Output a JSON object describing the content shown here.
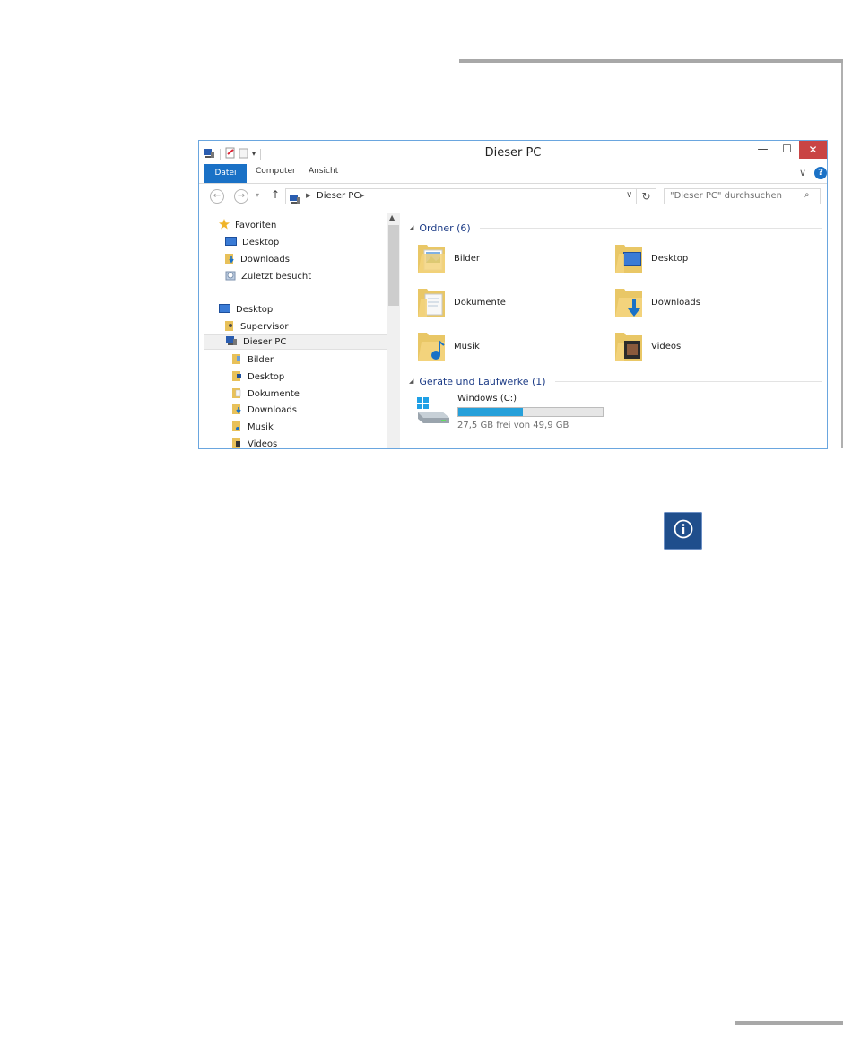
{
  "window": {
    "title": "Dieser PC",
    "controls": {
      "minimize": "—",
      "maximize": "☐",
      "close": "✕"
    }
  },
  "ribbon": {
    "tabs": [
      "Datei",
      "Computer",
      "Ansicht"
    ],
    "help": "?"
  },
  "address": {
    "path": "Dieser PC",
    "search_placeholder": "\"Dieser PC\" durchsuchen"
  },
  "nav_pane": {
    "items": [
      {
        "label": "Favoriten",
        "icon": "star-icon"
      },
      {
        "label": "Desktop",
        "icon": "desktop-icon"
      },
      {
        "label": "Downloads",
        "icon": "downloads-folder-icon"
      },
      {
        "label": "Zuletzt besucht",
        "icon": "recent-places-icon"
      },
      {
        "label": "Desktop",
        "icon": "desktop-icon"
      },
      {
        "label": "Supervisor",
        "icon": "user-folder-icon"
      },
      {
        "label": "Dieser PC",
        "icon": "this-pc-icon"
      },
      {
        "label": "Bilder",
        "icon": "pictures-folder-icon"
      },
      {
        "label": "Desktop",
        "icon": "desktop-folder-icon"
      },
      {
        "label": "Dokumente",
        "icon": "documents-folder-icon"
      },
      {
        "label": "Downloads",
        "icon": "downloads-folder-icon"
      },
      {
        "label": "Musik",
        "icon": "music-folder-icon"
      },
      {
        "label": "Videos",
        "icon": "videos-folder-icon"
      }
    ]
  },
  "content": {
    "folders_header": "Ordner (6)",
    "folders": [
      {
        "label": "Bilder",
        "icon": "pictures-folder-icon"
      },
      {
        "label": "Desktop",
        "icon": "desktop-folder-icon"
      },
      {
        "label": "Dokumente",
        "icon": "documents-folder-icon"
      },
      {
        "label": "Downloads",
        "icon": "downloads-folder-icon"
      },
      {
        "label": "Musik",
        "icon": "music-folder-icon"
      },
      {
        "label": "Videos",
        "icon": "videos-folder-icon"
      }
    ],
    "devices_header": "Geräte und Laufwerke (1)",
    "drive": {
      "label": "Windows (C:)",
      "free_text": "27,5 GB frei von 49,9 GB",
      "used_fraction": 0.449,
      "bar_color": "#26a0da"
    }
  },
  "colors": {
    "accent": "#1a71c6",
    "group_header": "#1e3d87",
    "close_button": "#c94444",
    "info_button": "#1f4e8c"
  },
  "info_button": {
    "icon": "info-icon"
  }
}
